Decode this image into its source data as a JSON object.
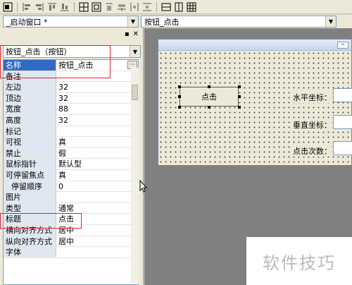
{
  "toolbar": {
    "icons": [
      "align-left-icon",
      "align-hcenter-icon",
      "align-right-icon",
      "align-top-icon",
      "align-vcenter-icon",
      "align-bottom-icon",
      "same-width-icon",
      "same-height-icon",
      "space-h-icon",
      "space-v-icon",
      "center-h-icon",
      "center-v-icon",
      "center-both-icon"
    ]
  },
  "window_selector": {
    "value": "_启动窗口 *"
  },
  "event_selector": {
    "value": "按钮_点击"
  },
  "property_panel": {
    "object_selector": "按钮_点击（按钮）",
    "properties": [
      {
        "name": "名称",
        "value": "按钮_点击"
      },
      {
        "name": "备注",
        "value": ""
      },
      {
        "name": "左边",
        "value": "32"
      },
      {
        "name": "顶边",
        "value": "32"
      },
      {
        "name": "宽度",
        "value": "88"
      },
      {
        "name": "高度",
        "value": "32"
      },
      {
        "name": "标记",
        "value": ""
      },
      {
        "name": "可视",
        "value": "真"
      },
      {
        "name": "禁止",
        "value": "假"
      },
      {
        "name": "鼠标指针",
        "value": "默认型"
      },
      {
        "name": "可停留焦点",
        "value": "真"
      },
      {
        "name": "停留顺序",
        "value": "0"
      },
      {
        "name": "图片",
        "value": ""
      },
      {
        "name": "类型",
        "value": "通常"
      },
      {
        "name": "标题",
        "value": "点击"
      },
      {
        "name": "横向对齐方式",
        "value": "居中"
      },
      {
        "name": "纵向对齐方式",
        "value": "居中"
      },
      {
        "name": "字体",
        "value": ""
      }
    ],
    "ellipsis": "···"
  },
  "design_form": {
    "button_label": "点击",
    "labels": [
      "水平坐标：",
      "垂直坐标：",
      "点击次数："
    ],
    "minimize": "–"
  },
  "watermark": "软件技巧",
  "colors": {
    "selection": "#316ac5",
    "highlight": "#e0203a",
    "designer_bg": "#808080"
  }
}
